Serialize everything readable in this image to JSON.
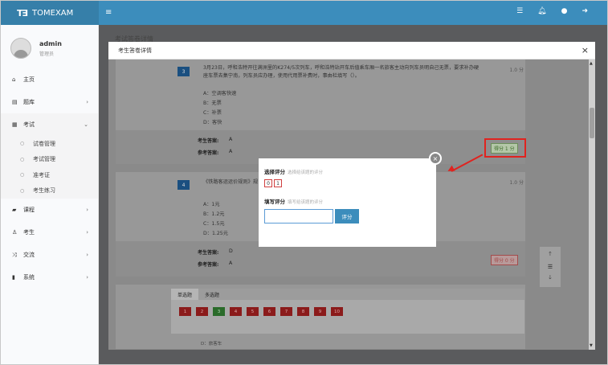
{
  "app": {
    "logo_mark": "T∃",
    "logo_text": "TOMEXAM",
    "menu_toggle": "≡"
  },
  "topbar_icons": [
    "list-icon",
    "bell-icon",
    "user-icon",
    "logout-icon"
  ],
  "user": {
    "name": "admin",
    "role": "管理员"
  },
  "sidebar": {
    "items": [
      {
        "label": "主页",
        "icon": "home-icon",
        "arrow": ""
      },
      {
        "label": "题库",
        "icon": "database-icon",
        "arrow": "›"
      },
      {
        "label": "考试",
        "icon": "calendar-icon",
        "arrow": "⌄"
      },
      {
        "label": "课程",
        "icon": "book-icon",
        "arrow": "›"
      },
      {
        "label": "考生",
        "icon": "user-icon",
        "arrow": "›"
      },
      {
        "label": "交流",
        "icon": "shuffle-icon",
        "arrow": "›"
      },
      {
        "label": "系统",
        "icon": "phone-icon",
        "arrow": "›"
      }
    ],
    "sub_items": [
      "试卷管理",
      "考试管理",
      "准考证",
      "考生练习"
    ]
  },
  "background": {
    "title": "考试答卷详情"
  },
  "modal": {
    "title": "考生答卷详情",
    "close": "×",
    "q3": {
      "number": "3",
      "text": "3月23日，呼和浩特开往满洲里的K274/5次列车，呼和浩特站开车后值乘车厢一名旅客主动向列车员明自己无票，要求补办硬座车票去集宁南，列车员应办理，使用代用票补费时，事由栏填写（）。",
      "score": "1.0 分",
      "options": [
        "A：空调客快速",
        "B：无票",
        "C：补票",
        "D：客快"
      ],
      "student_answer_label": "考生答案:",
      "student_answer": "A",
      "ref_answer_label": "参考答案:",
      "ref_answer": "A",
      "grade_label": "得分 1 分"
    },
    "q4": {
      "number": "4",
      "text": "《铁路客运运价规则》规",
      "score": "1.0 分",
      "options": [
        "A：1元",
        "B：1.2元",
        "C：1.5元",
        "D：1.25元"
      ],
      "student_answer_label": "考生答案:",
      "student_answer": "D",
      "ref_answer_label": "参考答案:",
      "ref_answer": "A",
      "grade_label": "得分 0 分"
    },
    "tabs": [
      "单选题",
      "多选题"
    ],
    "numbers": [
      "1",
      "2",
      "3",
      "4",
      "5",
      "6",
      "7",
      "8",
      "9",
      "10"
    ],
    "tail_text": "D：旅客车"
  },
  "side_tools": [
    "arrow-up-icon",
    "list-icon",
    "arrow-down-icon"
  ],
  "popup": {
    "select_title": "选择评分",
    "select_hint": "选择给该题的评分",
    "options": [
      "0",
      "1"
    ],
    "input_title": "填写评分",
    "input_hint": "填写给该题的评分",
    "input_value": "",
    "submit": "评分",
    "close": "×"
  },
  "colors": {
    "accent": "#3c8dbc",
    "highlight": "#e0231f"
  }
}
